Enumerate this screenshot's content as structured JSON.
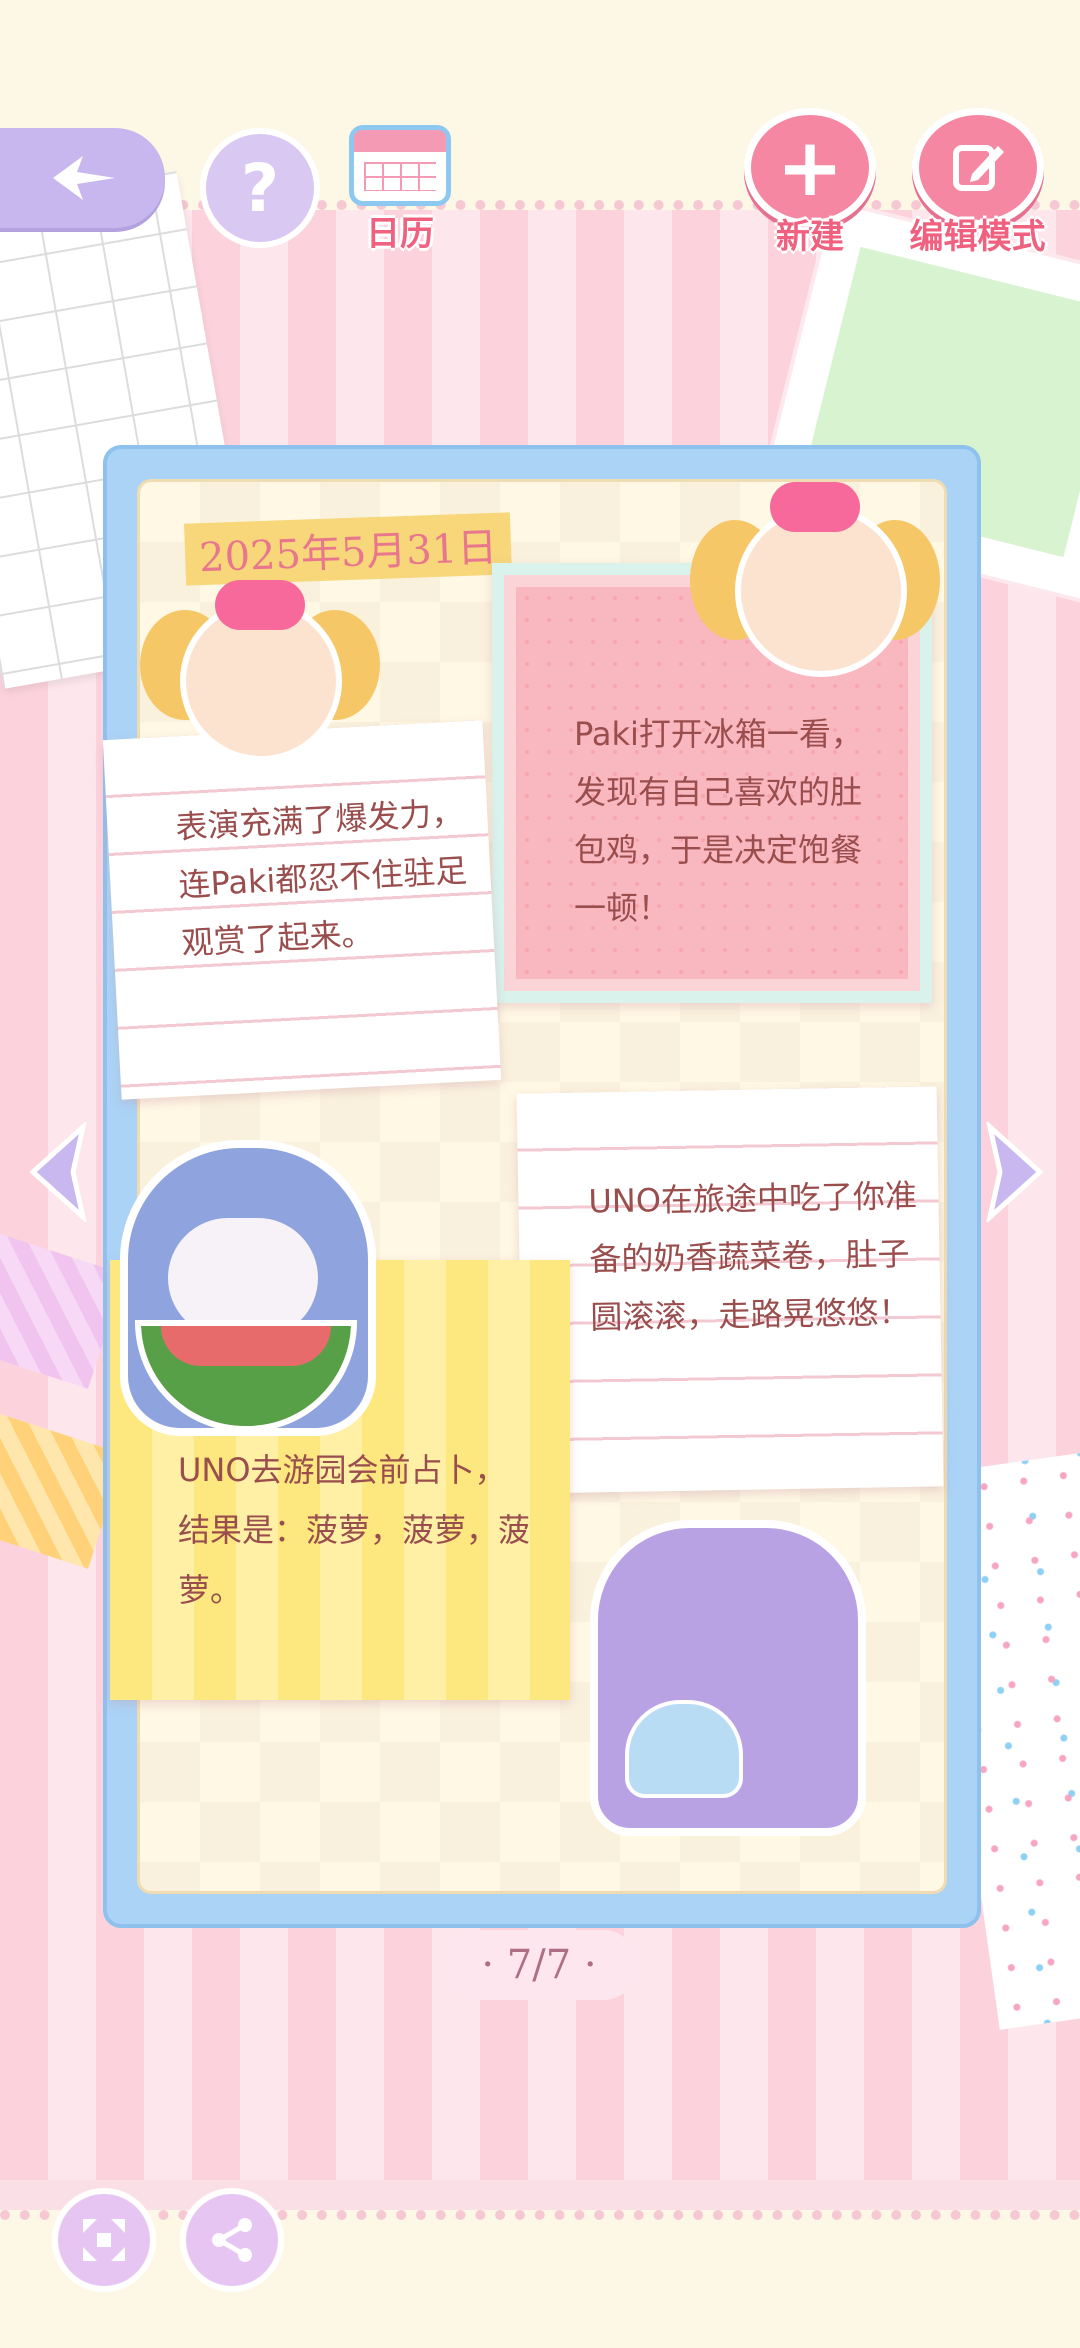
{
  "toolbar": {
    "calendar_label": "日历",
    "new_label": "新建",
    "edit_label": "编辑模式",
    "help_symbol": "?",
    "new_symbol": "+"
  },
  "journal": {
    "date": "2025年5月31日",
    "notes": [
      {
        "text": "表演充满了爆发力，连Paki都忍不住驻足观赏了起来。"
      },
      {
        "text": "Paki打开冰箱一看，发现有自己喜欢的肚包鸡，于是决定饱餐一顿！"
      },
      {
        "text": "UNO在旅途中吃了你准备的奶香蔬菜卷，肚子圆滚滚，走路晃悠悠！"
      },
      {
        "text": "UNO去游园会前占卜，结果是：菠萝，菠萝，菠萝。"
      }
    ]
  },
  "pagination": {
    "label": "· 7/7 ·"
  },
  "colors": {
    "accent_pink": "#f587a3",
    "label_pink": "#f0607f",
    "frame_blue": "#aad3f6",
    "note_text": "#9a4d4d"
  },
  "icons": [
    "back-icon",
    "help-icon",
    "calendar-icon",
    "plus-icon",
    "edit-icon",
    "arrow-left-icon",
    "arrow-right-icon",
    "fullscreen-icon",
    "share-icon"
  ]
}
